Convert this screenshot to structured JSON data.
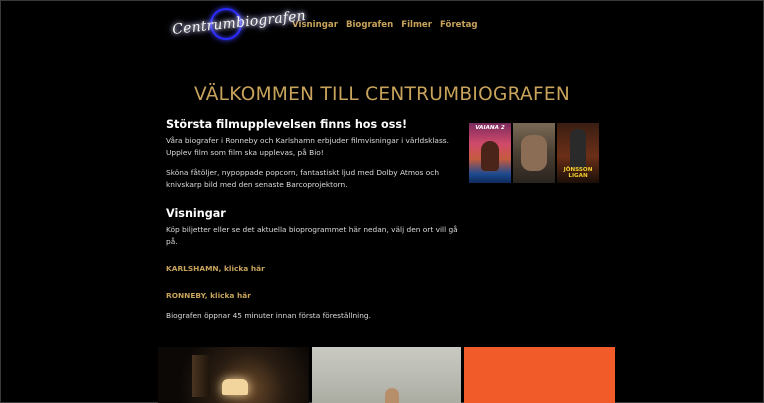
{
  "brand": {
    "logo_text": "Centrumbiografen"
  },
  "nav": {
    "items": [
      "Visningar",
      "Biografen",
      "Filmer",
      "Företag"
    ]
  },
  "main": {
    "title": "VÄLKOMMEN TILL CENTRUMBIOGRAFEN",
    "intro_heading": "Största filmupplevelsen finns hos oss!",
    "intro_p1": "Våra biografer i Ronneby och Karlshamn erbjuder filmvisningar i världsklass. Upplev film som film ska upplevas, på Bio!",
    "intro_p2": "Sköna fåtöljer, nypoppade popcorn, fantastiskt ljud med Dolby Atmos och knivskarp bild med den senaste Barcoprojektorn.",
    "showings_heading": "Visningar",
    "showings_p": "Köp biljetter eller se det aktuella bioprogrammet här nedan, välj den ort vill gå på.",
    "link_karlshamn": "KARLSHAMN, klicka här",
    "link_ronneby": "RONNEBY, klicka här",
    "opening_note": "Biografen öppnar 45 minuter innan första föreställning."
  },
  "posters": {
    "moana_title": "VAIANA 2",
    "jonsson_title": "JÖNSSON LIGAN"
  },
  "colors": {
    "accent_gold": "#c8a35b",
    "background": "#000000",
    "tile_orange": "#f15a29"
  }
}
